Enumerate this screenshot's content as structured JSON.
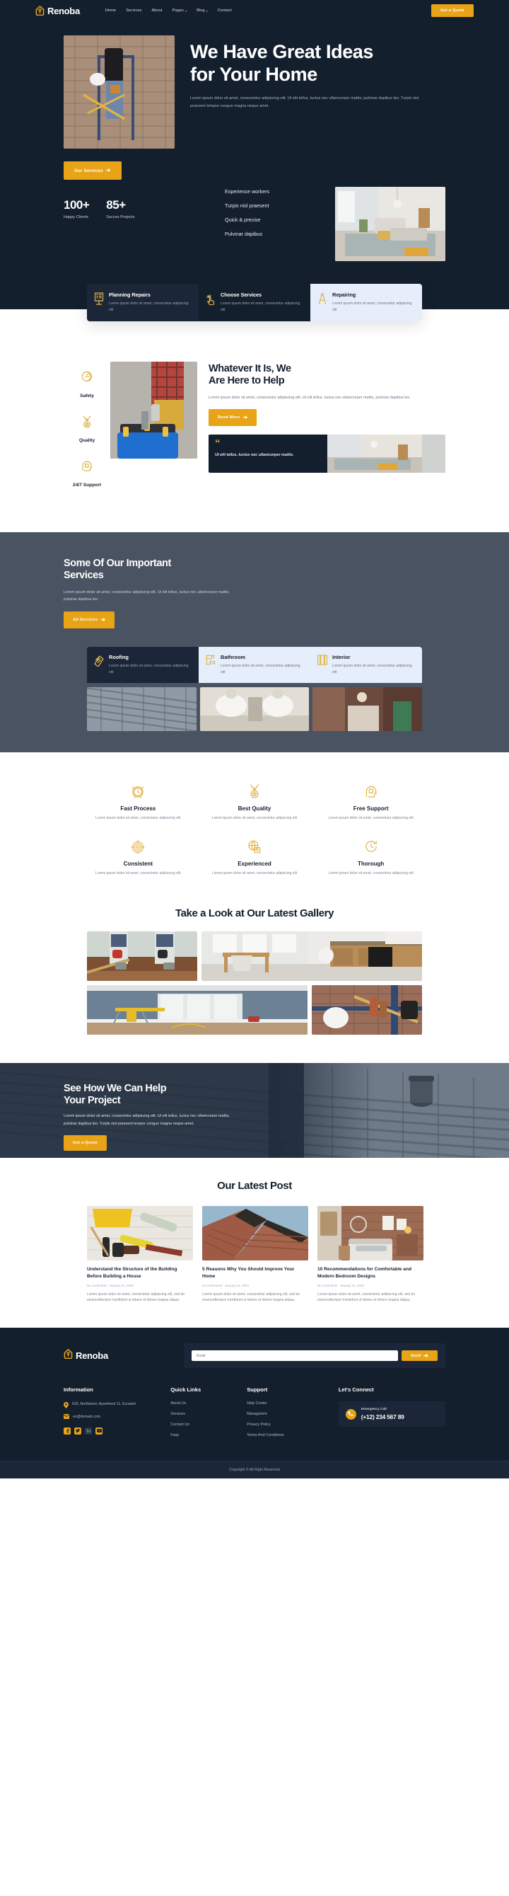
{
  "brand": {
    "name": "Renoba",
    "logo_icon": "house-wrench-icon",
    "accent": "#e8a317",
    "dark": "#141f2e"
  },
  "nav": {
    "items": [
      {
        "label": "Home",
        "has_caret": false
      },
      {
        "label": "Services",
        "has_caret": false
      },
      {
        "label": "About",
        "has_caret": false
      },
      {
        "label": "Pages",
        "has_caret": true
      },
      {
        "label": "Blog",
        "has_caret": true
      },
      {
        "label": "Contact",
        "has_caret": false
      }
    ],
    "cta": "Get a Quote"
  },
  "hero": {
    "title_line1": "We Have Great Ideas",
    "title_line2": "for Your Home",
    "paragraph": "Lorem ipsum dolor sit amet, consectetur adipiscing elit. Ut elit tellus, luctus nec ullamcorper mattis, pulvinar dapibus leo. Turpis nisl praesent tempor congue magna neque amet.",
    "cta": "Our Services",
    "stats": [
      {
        "value": "100+",
        "label": "Happy Clients"
      },
      {
        "value": "85+",
        "label": "Succes Projects"
      }
    ],
    "list": [
      "Experience workers",
      "Turpis nisl praesent",
      "Quick & precise",
      "Pulvinar dapibus"
    ],
    "image_left_alt": "worker-on-scaffold-photo",
    "image_right_alt": "modern-living-room-photo"
  },
  "feature_cards": [
    {
      "icon": "clipboard-checklist-icon",
      "title": "Planning Repairs",
      "text": "Lorem ipsum dolor sit amet, consectetur adipiscing elit",
      "theme": "dark"
    },
    {
      "icon": "hand-select-icon",
      "title": "Choose Services",
      "text": "Lorem ipsum dolor sit amet, consectetur adipiscing elit",
      "theme": "dark2"
    },
    {
      "icon": "compass-divider-icon",
      "title": "Repairing",
      "text": "Lorem ipsum dolor sit amet, consectetur adipiscing elit",
      "theme": "light"
    }
  ],
  "help": {
    "side_items": [
      {
        "icon": "safety-shield-icon",
        "label": "Safety"
      },
      {
        "icon": "medal-icon",
        "label": "Quality"
      },
      {
        "icon": "headset-support-icon",
        "label": "24/7 Support"
      }
    ],
    "title_line1": "Whatever It Is, We",
    "title_line2": "Are Here to Help",
    "paragraph": "Lorem ipsum dolor sit amet, consectetur adipiscing elit. Ut elit tellus, luctus nec ullamcorper mattis, pulvinar dapibus leo.",
    "cta": "Read More",
    "quote": "Ut elit tellus, luctus nec ullamcorper mattis.",
    "image_alt": "worker-carrying-toolbox-photo",
    "quote_image_alt": "living-room-photo"
  },
  "services": {
    "title_line1": "Some Of Our Important",
    "title_line2": "Services",
    "paragraph": "Lorem ipsum dolor sit amet, consectetur adipiscing elit. Ut elit tellus, luctus nec ullamcorper mattis, pulvinar dapibus leo.",
    "cta": "All Services",
    "tabs": [
      {
        "icon": "roof-shingle-icon",
        "title": "Roofing",
        "text": "Lorem ipsum dolor sit amet, consectetur adipiscing elit",
        "active": true
      },
      {
        "icon": "bathroom-fixture-icon",
        "title": "Bathroom",
        "text": "Lorem ipsum dolor sit amet, consectetur adipiscing elit",
        "active": false
      },
      {
        "icon": "interior-wall-icon",
        "title": "Interior",
        "text": "Lorem ipsum dolor sit amet, consectetur adipiscing elit",
        "active": false
      }
    ],
    "images": [
      "roof-tiles-photo",
      "bathroom-interior-photo",
      "interior-room-photo"
    ]
  },
  "features": [
    {
      "icon": "alarm-clock-icon",
      "title": "Fast Process",
      "text": "Lorem ipsum dolor sit amet, consectetur adipiscing elit"
    },
    {
      "icon": "medal-star-icon",
      "title": "Best Quality",
      "text": "Lorem ipsum dolor sit amet, consectetur adipiscing elit"
    },
    {
      "icon": "headset-icon",
      "title": "Free Support",
      "text": "Lorem ipsum dolor sit amet, consectetur adipiscing elit"
    },
    {
      "icon": "target-icon",
      "title": "Consistent",
      "text": "Lorem ipsum dolor sit amet, consectetur adipiscing elit"
    },
    {
      "icon": "globe-document-icon",
      "title": "Experienced",
      "text": "Lorem ipsum dolor sit amet, consectetur adipiscing elit"
    },
    {
      "icon": "clock-arrow-icon",
      "title": "Thorough",
      "text": "Lorem ipsum dolor sit amet, consectetur adipiscing elit"
    }
  ],
  "gallery": {
    "title": "Take a Look at Our Latest Gallery",
    "images": [
      "floor-demolition-photo",
      "dining-kitchen-photo",
      "empty-room-renovation-photo",
      "helmet-tools-brick-photo"
    ]
  },
  "cta_banner": {
    "title_line1": "See How We Can Help",
    "title_line2": "Your Project",
    "paragraph": "Lorem ipsum dolor sit amet, consectetur adipiscing elit. Ut elit tellus, luctus nec ullamcorper mattis, pulvinar dapibus leo. Turpis nisl praesent tempor congue magna neque amet.",
    "cta": "Get a Quote",
    "background_alt": "roof-tiles-vent-photo"
  },
  "blog": {
    "title": "Our Latest Post",
    "posts": [
      {
        "image_alt": "blueprints-helmet-tools-photo",
        "title": "Understand the Structure of the Building Before Building a House",
        "meta": "No Comments - January 31, 2023",
        "excerpt": "Lorem ipsum dolor sit amet, consectetur adipiscing elit, sed do eiusmodtempor incididunt ut labore et dolore magna aliqua."
      },
      {
        "image_alt": "shingle-roof-photo",
        "title": "5 Reasons Why You Should Improve Your Home",
        "meta": "No Comments - January 31, 2023",
        "excerpt": "Lorem ipsum dolor sit amet, consectetur adipiscing elit, sed do eiusmodtempor incididunt ut labore et dolore magna aliqua."
      },
      {
        "image_alt": "modern-bedroom-brick-photo",
        "title": "10 Recommendations for Comfortable and Modern Bedroom Designs",
        "meta": "No Comments - January 31, 2023",
        "excerpt": "Lorem ipsum dolor sit amet, consectetur adipiscing elit, sed do eiusmodtempor incididunt ut labore et dolore magna aliqua."
      }
    ]
  },
  "footer": {
    "newsletter": {
      "placeholder": "Email",
      "value": "",
      "button": "Send"
    },
    "information": {
      "heading": "Information",
      "address": "633, Northwest, Apartment 11, Ecuador",
      "email": "ex@domain.com",
      "socials": [
        "facebook-icon",
        "twitter-icon",
        "linkedin-icon",
        "youtube-icon"
      ]
    },
    "quick_links": {
      "heading": "Quick Links",
      "items": [
        "About Us",
        "Services",
        "Contact Us",
        "Faqs"
      ]
    },
    "support": {
      "heading": "Support",
      "items": [
        "Help Center",
        "Managment",
        "Privacy Policy",
        "Terms And Conditions"
      ]
    },
    "connect": {
      "heading": "Let's Connect",
      "emergency_label": "Emergency Call",
      "phone": "(+12) 234 567 89"
    },
    "copyright": "Copyright © All Right Reserved"
  }
}
